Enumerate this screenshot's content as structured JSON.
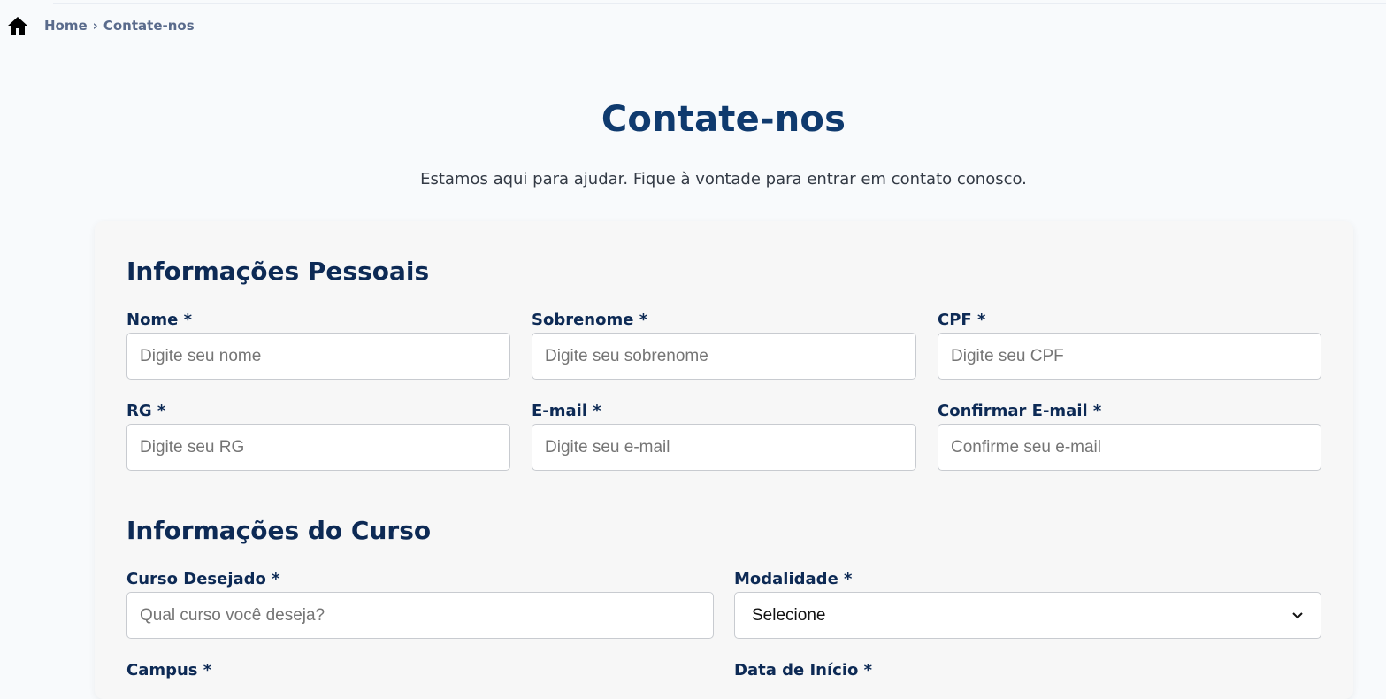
{
  "breadcrumb": {
    "home_icon": "home-icon",
    "home": "Home",
    "separator": "›",
    "current": "Contate-nos"
  },
  "header": {
    "title": "Contate-nos",
    "subtitle": "Estamos aqui para ajudar. Fique à vontade para entrar em contato conosco."
  },
  "personal": {
    "title": "Informações Pessoais",
    "nome": {
      "label": "Nome *",
      "placeholder": "Digite seu nome"
    },
    "sobrenome": {
      "label": "Sobrenome *",
      "placeholder": "Digite seu sobrenome"
    },
    "cpf": {
      "label": "CPF *",
      "placeholder": "Digite seu CPF"
    },
    "rg": {
      "label": "RG *",
      "placeholder": "Digite seu RG"
    },
    "email": {
      "label": "E-mail *",
      "placeholder": "Digite seu e-mail"
    },
    "confirm_email": {
      "label": "Confirmar E-mail *",
      "placeholder": "Confirme seu e-mail"
    }
  },
  "course": {
    "title": "Informações do Curso",
    "curso": {
      "label": "Curso Desejado *",
      "placeholder": "Qual curso você deseja?"
    },
    "modalidade": {
      "label": "Modalidade *",
      "selected": "Selecione",
      "icon": "chevron-down-icon"
    },
    "campus": {
      "label": "Campus *"
    },
    "data_inicio": {
      "label": "Data de Início *"
    }
  },
  "colors": {
    "primary_dark": "#0d2a55",
    "title_blue": "#0f3a6e",
    "breadcrumb": "#5a6b8c",
    "page_bg": "#f8fafc",
    "card_bg": "#f7f7f7"
  }
}
